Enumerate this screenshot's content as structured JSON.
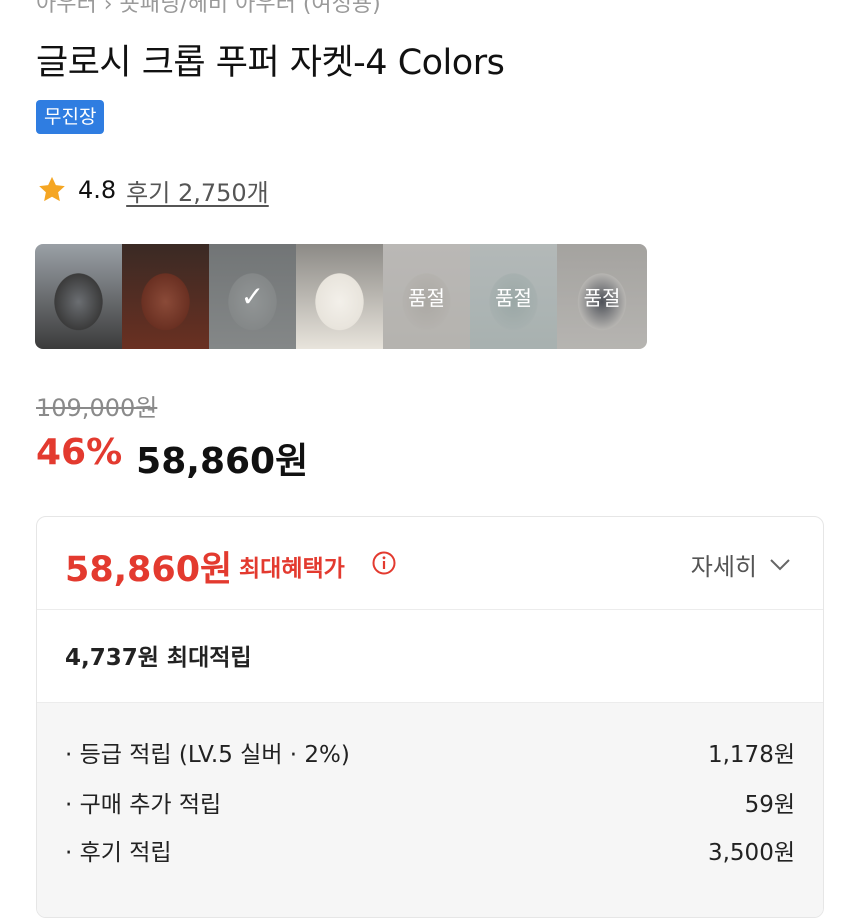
{
  "breadcrumb": "아우터 › 숏패딩/헤비 아우터 (여성용)",
  "product": {
    "title": "글로시 크롭 푸퍼 자켓-4 Colors",
    "badge": "무진장"
  },
  "rating": {
    "icon": "star-icon",
    "score": "4.8",
    "reviews": "후기 2,750개"
  },
  "swatches": [
    {
      "name": "swatch-black-model",
      "colors": [
        "#3b3b3b",
        "#6b6e72",
        "#9aa0a6"
      ],
      "soldout": false,
      "selected": false,
      "label": ""
    },
    {
      "name": "swatch-brown-model",
      "colors": [
        "#6a3022",
        "#8a4a38",
        "#3a2a24"
      ],
      "soldout": false,
      "selected": false,
      "label": ""
    },
    {
      "name": "swatch-gray-jacket",
      "colors": [
        "#8f9596",
        "#a6adae",
        "#6d7375"
      ],
      "soldout": false,
      "selected": true,
      "label": "✓"
    },
    {
      "name": "swatch-ivory-model",
      "colors": [
        "#e8e4dc",
        "#f3f0ea",
        "#8c8a86"
      ],
      "soldout": false,
      "selected": false,
      "label": ""
    },
    {
      "name": "swatch-ivory-jacket",
      "colors": [
        "#e7e3dc",
        "#d6d1c8",
        "#f0ede8"
      ],
      "soldout": true,
      "selected": false,
      "label": "품절"
    },
    {
      "name": "swatch-mint-jacket",
      "colors": [
        "#cfe0de",
        "#b8cfcc",
        "#e4eeed"
      ],
      "soldout": true,
      "selected": false,
      "label": "품절"
    },
    {
      "name": "swatch-ivory-model-2",
      "colors": [
        "#e9e6e0",
        "#2d3340",
        "#c9c6c0"
      ],
      "soldout": true,
      "selected": false,
      "label": "품절"
    }
  ],
  "price": {
    "original": "109,000원",
    "discount": "46%",
    "sale": "58,860원"
  },
  "benefit": {
    "price": "58,860원",
    "label": "최대혜택가",
    "info_icon": "info-icon",
    "detail": "자세히",
    "detail_icon": "chevron-down-icon",
    "points_summary": "4,737원 최대적립",
    "rows": [
      {
        "label": "· 등급 적립 (LV.5 실버 · 2%)",
        "value": "1,178원"
      },
      {
        "label": "· 구매 추가 적립",
        "value": "59원"
      },
      {
        "label": "· 후기 적립",
        "value": "3,500원"
      }
    ]
  },
  "colors": {
    "accent_red": "#e33a2f",
    "badge_blue": "#2f7de1",
    "star_orange": "#f5a623"
  }
}
